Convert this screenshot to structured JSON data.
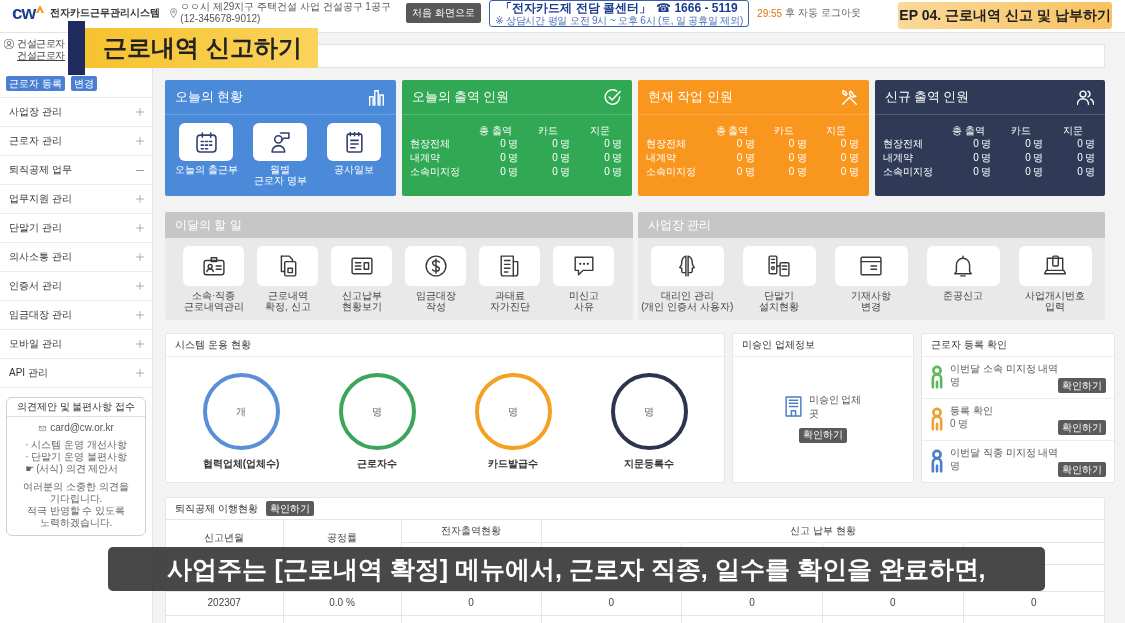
{
  "header": {
    "logo": "cw",
    "system_name": "전자카드근무관리시스템",
    "site": "ㅇㅇ시 제29지구 주택건설 사업 건설공구 1공구 (12-345678-9012)",
    "home_button": "처음 화면으로",
    "call_center": {
      "title": "「전자카드제 전담 콜센터」",
      "phone": "☎ 1666 - 5119",
      "hours": "※ 상담시간 평일 오전 9시 ~ 오후 6시 (토, 일 공휴일 제외)"
    },
    "timer": "29:55",
    "timer_note": "후 자동 로그아웃"
  },
  "sidebar": {
    "user": {
      "company": "건설근로자",
      "name": "건설근로자"
    },
    "buttons": [
      "근로자 등록",
      "변경"
    ],
    "menu": [
      {
        "label": "사업장 관리",
        "expanded": false
      },
      {
        "label": "근로자 관리",
        "expanded": false
      },
      {
        "label": "퇴직공제 업무",
        "expanded": true
      },
      {
        "label": "업무지원 관리",
        "expanded": false
      },
      {
        "label": "단말기 관리",
        "expanded": false
      },
      {
        "label": "의사소통 관리",
        "expanded": false
      },
      {
        "label": "인증서 관리",
        "expanded": false
      },
      {
        "label": "임금대장 관리",
        "expanded": false
      },
      {
        "label": "모바일 관리",
        "expanded": false
      },
      {
        "label": "API 관리",
        "expanded": false
      }
    ],
    "feedback": {
      "title": "의견제안 및 불편사항 접수",
      "email": "card@cw.or.kr",
      "items": [
        "· 시스템 운영 개선사항",
        "· 단말기 운영 불편사항"
      ],
      "form_icon": "☛",
      "form_link": "(서식) 의견 제안서",
      "message": [
        "여러분의 소중한 의견을 기다립니다.",
        "적극 반영할 수 있도록 노력하겠습니다."
      ]
    }
  },
  "status_cards": [
    {
      "kind": "tiles",
      "title": "오늘의 현황",
      "color": "#4a8ad9",
      "tiles": [
        {
          "lines": [
            "오늘의 출근부"
          ]
        },
        {
          "lines": [
            "월별",
            "근로자 명부"
          ]
        },
        {
          "lines": [
            "공사일보"
          ]
        }
      ]
    },
    {
      "kind": "table",
      "title": "오늘의 출역 인원",
      "color": "#31a853",
      "columns": [
        "총 출역",
        "카드",
        "지문"
      ],
      "rows": [
        {
          "label": "현장전체",
          "values": [
            "0 명",
            "0 명",
            "0 명"
          ]
        },
        {
          "label": "내계약",
          "values": [
            "0 명",
            "0 명",
            "0 명"
          ]
        },
        {
          "label": "소속미지정",
          "values": [
            "0 명",
            "0 명",
            "0 명"
          ]
        }
      ]
    },
    {
      "kind": "table",
      "title": "현재 작업 인원",
      "color": "#f9961e",
      "columns": [
        "총 출역",
        "카드",
        "지문"
      ],
      "rows": [
        {
          "label": "현장전체",
          "values": [
            "0 명",
            "0 명",
            "0 명"
          ]
        },
        {
          "label": "내계약",
          "values": [
            "0 명",
            "0 명",
            "0 명"
          ]
        },
        {
          "label": "소속미지정",
          "values": [
            "0 명",
            "0 명",
            "0 명"
          ]
        }
      ]
    },
    {
      "kind": "table",
      "title": "신규 출역 인원",
      "color": "#2e3a56",
      "columns": [
        "총 출역",
        "카드",
        "지문"
      ],
      "rows": [
        {
          "label": "현장전체",
          "values": [
            "0 명",
            "0 명",
            "0 명"
          ]
        },
        {
          "label": "내계약",
          "values": [
            "0 명",
            "0 명",
            "0 명"
          ]
        },
        {
          "label": "소속미지정",
          "values": [
            "0 명",
            "0 명",
            "0 명"
          ]
        }
      ]
    }
  ],
  "task_panels": [
    {
      "title": "이달의 할 일",
      "tiles": [
        {
          "lines": [
            "소속·직종",
            "근로내역관리"
          ]
        },
        {
          "lines": [
            "근로내역",
            "확정, 신고"
          ]
        },
        {
          "lines": [
            "신고납부",
            "현황보기"
          ]
        },
        {
          "lines": [
            "임금대장",
            "작성"
          ]
        },
        {
          "lines": [
            "과태료",
            "자가진단"
          ]
        },
        {
          "lines": [
            "미신고",
            "사유"
          ]
        }
      ]
    },
    {
      "title": "사업장 관리",
      "tiles": [
        {
          "lines": [
            "대리인 관리",
            "(개인 인증서 사용자)"
          ]
        },
        {
          "lines": [
            "단말기",
            "설치현황"
          ]
        },
        {
          "lines": [
            "기재사항",
            "변경"
          ]
        },
        {
          "lines": [
            "준공신고"
          ]
        },
        {
          "lines": [
            "사업개시번호",
            "입력"
          ]
        }
      ]
    }
  ],
  "system_status": {
    "title": "시스템 운용 현황",
    "gauges": [
      {
        "unit": "개",
        "label": "협력업체(업체수)",
        "color": "#5a8fd8"
      },
      {
        "unit": "명",
        "label": "근로자수",
        "color": "#3ba55b"
      },
      {
        "unit": "명",
        "label": "카드발급수",
        "color": "#f4a022"
      },
      {
        "unit": "명",
        "label": "지문등록수",
        "color": "#2d3450"
      }
    ]
  },
  "unapproved": {
    "title": "미승인 업체정보",
    "label": "미승인 업체",
    "unit": "곳",
    "button": "확인하기"
  },
  "worker_check": {
    "title": "근로자 등록 확인",
    "items": [
      {
        "label": "이번달 소속 미지정 내역",
        "value": "명",
        "color": "#5cb85c",
        "button": "확인하기"
      },
      {
        "label": "등록 확인",
        "value": "0 명",
        "color": "#f0a030",
        "button": "확인하기"
      },
      {
        "label": "이번달 직종 미지정 내역",
        "value": "명",
        "color": "#4a80c8",
        "button": "확인하기"
      }
    ]
  },
  "retirement": {
    "title": "퇴직공제 이행현황",
    "button": "확인하기",
    "columns": [
      "신고년월",
      "공정률"
    ],
    "groups": [
      "전자출역현황",
      "신고 납부 현황"
    ],
    "rows": [
      {
        "cells": [
          "202307",
          "0.0 %",
          "0",
          "0",
          "0",
          "0",
          "0"
        ]
      }
    ]
  },
  "overlays": {
    "title_banner": "근로내역 신고하기",
    "episode_banner": "EP 04. 근로내역 신고 및 납부하기",
    "subtitle": "사업주는 [근로내역 확정] 메뉴에서, 근로자 직종, 일수를 확인을 완료하면,"
  }
}
